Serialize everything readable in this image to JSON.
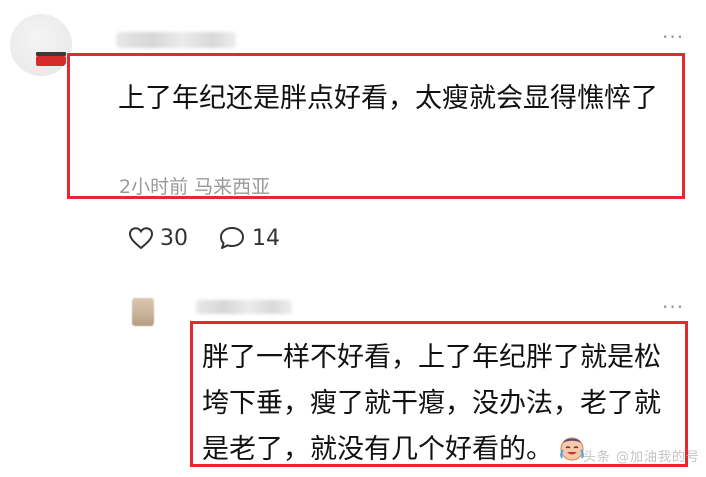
{
  "comments": [
    {
      "text": "上了年纪还是胖点好看，太瘦就会显得憔悴了",
      "time": "2小时前",
      "location": "马来西亚",
      "likes": "30",
      "replies": "14"
    },
    {
      "text": "胖了一样不好看，上了年纪胖了就是松垮下垂，瘦了就干瘪，没办法，老了就是老了，就没有几个好看的。",
      "emoji": "crying-laughing-emoji"
    }
  ],
  "icons": {
    "more": "more-dots-icon",
    "like": "heart-icon",
    "reply": "comment-bubble-icon"
  },
  "colors": {
    "highlight_box": "#e8282f",
    "meta_text": "#9a9a9a"
  },
  "watermark": "头条 @加油我的号"
}
